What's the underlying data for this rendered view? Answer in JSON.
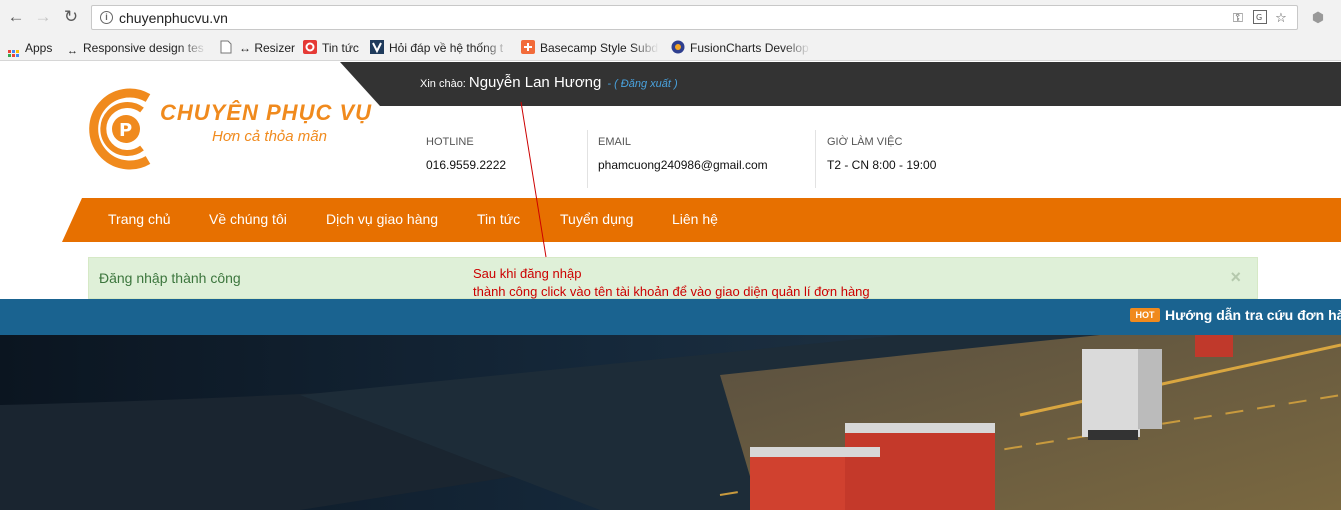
{
  "browser": {
    "url": "chuyenphucvu.vn",
    "bookmarks": [
      {
        "label": "Apps"
      },
      {
        "label": "Responsive design tes"
      },
      {
        "label": "↔ Resizer"
      },
      {
        "label": "Tin tức"
      },
      {
        "label": "Hỏi đáp về hệ thống t"
      },
      {
        "label": "Basecamp Style Subd"
      },
      {
        "label": "FusionCharts Develop"
      }
    ]
  },
  "header": {
    "greeting_label": "Xin chào:",
    "user_name": "Nguyễn Lan Hương",
    "logout_label": "- ( Đăng xuất )"
  },
  "logo": {
    "title": "CHUYÊN PHỤC VỤ",
    "slogan": "Hơn cả thỏa mãn"
  },
  "contacts": [
    {
      "label": "HOTLINE",
      "value": "016.9559.2222"
    },
    {
      "label": "EMAIL",
      "value": "phamcuong240986@gmail.com"
    },
    {
      "label": "GIỜ LÀM VIỆC",
      "value": "T2 - CN 8:00 - 19:00"
    }
  ],
  "menu": [
    "Trang chủ",
    "Về chúng tôi",
    "Dịch vụ giao hàng",
    "Tin tức",
    "Tuyển dụng",
    "Liên hệ"
  ],
  "alert": {
    "message": "Đăng nhập thành công",
    "close": "×"
  },
  "annotation": {
    "line1": "Sau khi đăng nhập",
    "line2": "thành công  click vào tên tài khoản để vào giao diện quản lí đơn hàng"
  },
  "ticker": {
    "badge": "HOT",
    "text": "Hướng dẫn tra cứu đơn hà"
  },
  "colors": {
    "brand_orange": "#e77000",
    "topbar": "#333333",
    "ticker_blue": "#1a6390",
    "alert_green": "#3c763d",
    "annotation_red": "#cc0000"
  }
}
